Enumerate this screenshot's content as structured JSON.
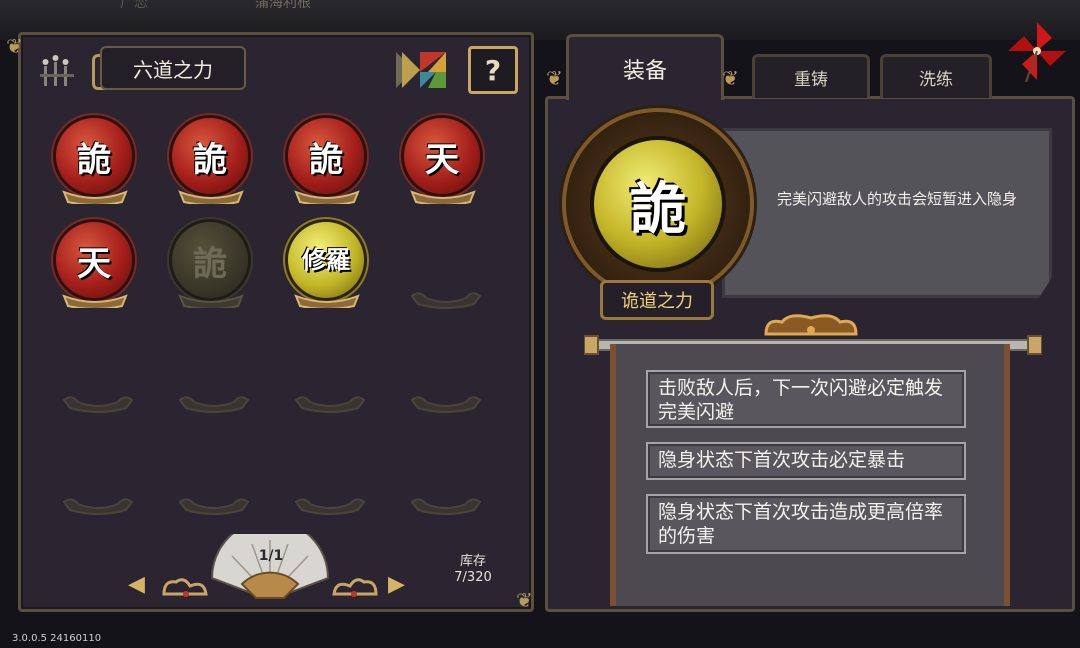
{
  "background": {
    "top_text_1": "广恋",
    "top_text_2": "蒲海利根"
  },
  "left_panel": {
    "title": "六道之力",
    "help_label": "?",
    "slots": [
      {
        "glyph": "詭",
        "state": "red"
      },
      {
        "glyph": "詭",
        "state": "red"
      },
      {
        "glyph": "詭",
        "state": "red"
      },
      {
        "glyph": "天",
        "state": "red"
      },
      {
        "glyph": "天",
        "state": "red"
      },
      {
        "glyph": "詭",
        "state": "dim"
      },
      {
        "glyph": "修羅",
        "state": "gold"
      }
    ],
    "page": "1/1",
    "prev_arrow": "◀",
    "next_arrow": "▶",
    "stock_label": "库存",
    "stock_count": "7/320"
  },
  "right_panel": {
    "tabs": [
      "装备",
      "重铸",
      "洗练"
    ],
    "selected": {
      "glyph": "詭",
      "name": "诡道之力",
      "description": "完美闪避敌人的攻击会短暂进入隐身"
    },
    "effects": [
      "击败敌人后，下一次闪避必定触发完美闪避",
      "隐身状态下首次攻击必定暴击",
      "隐身状态下首次攻击造成更高倍率的伤害"
    ]
  },
  "version": "3.0.0.5 24160110",
  "colors": {
    "gold": "#c9a664",
    "red_orb": "#a41f1a",
    "yellow_orb": "#c4b628",
    "panel": "#2a2530"
  }
}
